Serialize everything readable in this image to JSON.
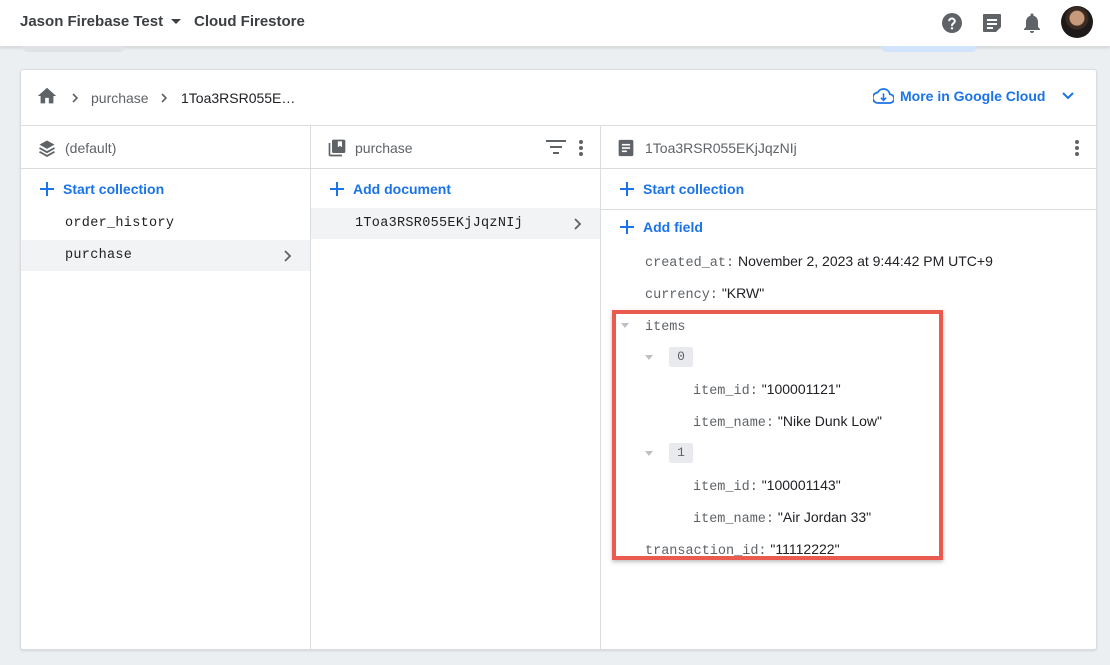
{
  "topbar": {
    "project_name": "Jason Firebase Test",
    "product_title": "Cloud Firestore",
    "icons": [
      "help-icon",
      "feedback-icon",
      "notifications-icon",
      "account-avatar"
    ]
  },
  "breadcrumb": {
    "items": [
      "purchase",
      "1Toa3RSR055E…"
    ]
  },
  "more_cloud": {
    "label": "More in Google Cloud"
  },
  "columns": {
    "root": {
      "title": "(default)",
      "action": "Start collection",
      "items": [
        "order_history",
        "purchase"
      ],
      "selected": "purchase"
    },
    "collection": {
      "title": "purchase",
      "action": "Add document",
      "items": [
        "1Toa3RSR055EKjJqzNIj"
      ]
    },
    "document": {
      "title": "1Toa3RSR055EKjJqzNIj",
      "action_collection": "Start collection",
      "action_field": "Add field",
      "fields": {
        "created_at_key": "created_at:",
        "created_at_val": "November 2, 2023 at 9:44:42 PM UTC+9",
        "currency_key": "currency:",
        "currency_val": "\"KRW\"",
        "items_key": "items",
        "items": [
          {
            "index": "0",
            "item_id_key": "item_id:",
            "item_id_val": "\"100001121\"",
            "item_name_key": "item_name:",
            "item_name_val": "\"Nike Dunk Low\""
          },
          {
            "index": "1",
            "item_id_key": "item_id:",
            "item_id_val": "\"100001143\"",
            "item_name_key": "item_name:",
            "item_name_val": "\"Air Jordan 33\""
          }
        ],
        "transaction_id_key": "transaction_id:",
        "transaction_id_val": "\"11112222\""
      }
    }
  },
  "colors": {
    "accent": "#1a73e8",
    "highlight": "#ea5a4e"
  }
}
